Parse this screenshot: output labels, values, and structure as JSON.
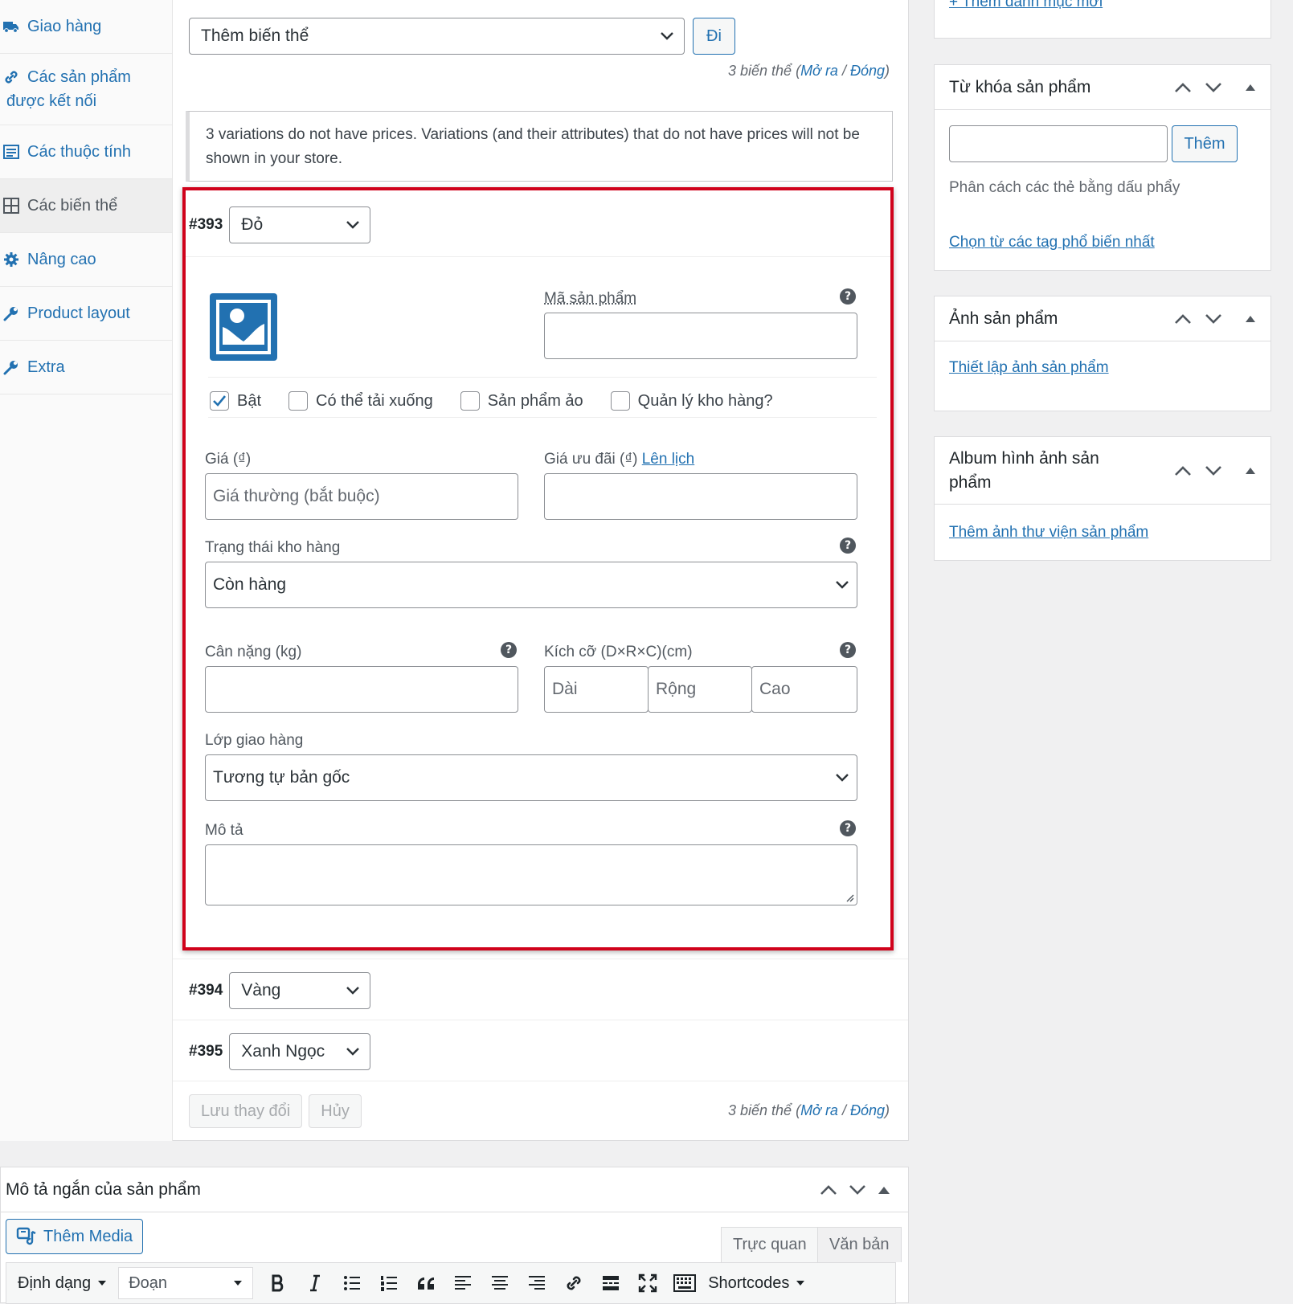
{
  "tabs": [
    {
      "label": "Giao hàng",
      "icon": "truck-icon"
    },
    {
      "label": "Các sản phẩm được kết nối",
      "icon": "link-icon"
    },
    {
      "label": "Các thuộc tính",
      "icon": "list-icon"
    },
    {
      "label": "Các biến thể",
      "icon": "grid-icon"
    },
    {
      "label": "Nâng cao",
      "icon": "gear-icon"
    },
    {
      "label": "Product layout",
      "icon": "wrench-icon"
    },
    {
      "label": "Extra",
      "icon": "wrench-icon"
    }
  ],
  "toolbar": {
    "bulk_select": "Thêm biến thể",
    "go_label": "Đi"
  },
  "count": {
    "text": "3 biến thể",
    "open": "Mở ra",
    "sep": " / ",
    "close": "Đóng"
  },
  "notice": "3 variations do not have prices. Variations (and their attributes) that do not have prices will not be shown in your store.",
  "variations": [
    {
      "id": "#393",
      "value": "Đỏ"
    },
    {
      "id": "#394",
      "value": "Vàng"
    },
    {
      "id": "#395",
      "value": "Xanh Ngọc"
    }
  ],
  "form": {
    "sku_label": "Mã sản phẩm",
    "checkboxes": [
      {
        "label": "Bật",
        "checked": true
      },
      {
        "label": "Có thể tải xuống",
        "checked": false
      },
      {
        "label": "Sản phẩm ảo",
        "checked": false
      },
      {
        "label": "Quản lý kho hàng?",
        "checked": false
      }
    ],
    "price_label": "Giá (₫)",
    "price_placeholder": "Giá thường (bắt buộc)",
    "sale_label": "Giá ưu đãi (₫)",
    "schedule_link": "Lên lịch",
    "stock_label": "Trạng thái kho hàng",
    "stock_value": "Còn hàng",
    "weight_label": "Cân nặng (kg)",
    "size_label": "Kích cỡ (D×R×C)(cm)",
    "length_ph": "Dài",
    "width_ph": "Rộng",
    "height_ph": "Cao",
    "shipping_label": "Lớp giao hàng",
    "shipping_value": "Tương tự bản gốc",
    "desc_label": "Mô tả"
  },
  "footer": {
    "save": "Lưu thay đổi",
    "cancel": "Hủy"
  },
  "short_desc": {
    "title": "Mô tả ngắn của sản phẩm",
    "add_media": "Thêm Media",
    "tab_visual": "Trực quan",
    "tab_text": "Văn bản",
    "format": "Định dạng",
    "paragraph": "Đoạn",
    "shortcodes": "Shortcodes"
  },
  "sidebar": {
    "top_link": "+ Thêm danh mục mới",
    "tags": {
      "title": "Từ khóa sản phẩm",
      "add_btn": "Thêm",
      "hint": "Phân cách các thẻ bằng dấu phẩy",
      "popular_link": "Chọn từ các tag phổ biến nhất"
    },
    "image": {
      "title": "Ảnh sản phẩm",
      "link": "Thiết lập ảnh sản phẩm"
    },
    "gallery": {
      "title": "Album hình ảnh sản phẩm",
      "link": "Thêm ảnh thư viện sản phẩm"
    }
  },
  "colors": {
    "accent": "#2271b1",
    "highlight": "#d0021b"
  }
}
